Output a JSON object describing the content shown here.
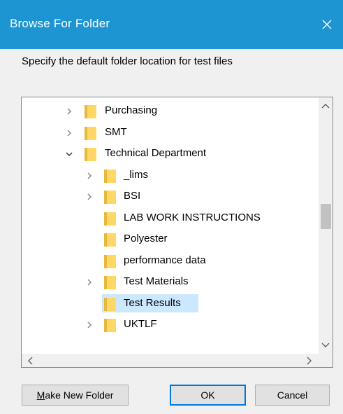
{
  "window": {
    "title": "Browse For Folder",
    "close_icon": "close-icon"
  },
  "instruction": "Specify the default folder location for test files",
  "tree": {
    "items": [
      {
        "label": "Purchasing",
        "level": 1,
        "expander": "collapsed",
        "selected": false
      },
      {
        "label": "SMT",
        "level": 1,
        "expander": "collapsed",
        "selected": false
      },
      {
        "label": "Technical Department",
        "level": 1,
        "expander": "expanded",
        "selected": false
      },
      {
        "label": "_lims",
        "level": 2,
        "expander": "collapsed",
        "selected": false
      },
      {
        "label": "BSI",
        "level": 2,
        "expander": "collapsed",
        "selected": false
      },
      {
        "label": "LAB WORK INSTRUCTIONS",
        "level": 2,
        "expander": "none",
        "selected": false
      },
      {
        "label": "Polyester",
        "level": 2,
        "expander": "none",
        "selected": false
      },
      {
        "label": "performance data",
        "level": 2,
        "expander": "none",
        "selected": false
      },
      {
        "label": "Test Materials",
        "level": 2,
        "expander": "collapsed",
        "selected": false
      },
      {
        "label": "Test Results",
        "level": 2,
        "expander": "none",
        "selected": true
      },
      {
        "label": "UKTLF",
        "level": 2,
        "expander": "collapsed",
        "selected": false
      }
    ]
  },
  "buttons": {
    "make_new_folder_prefix": "M",
    "make_new_folder_rest": "ake New Folder",
    "ok": "OK",
    "cancel": "Cancel"
  },
  "colors": {
    "titlebar": "#1d95d3",
    "selection": "#cce8ff",
    "folder": "#ffd766",
    "default_button_border": "#0078d7"
  }
}
